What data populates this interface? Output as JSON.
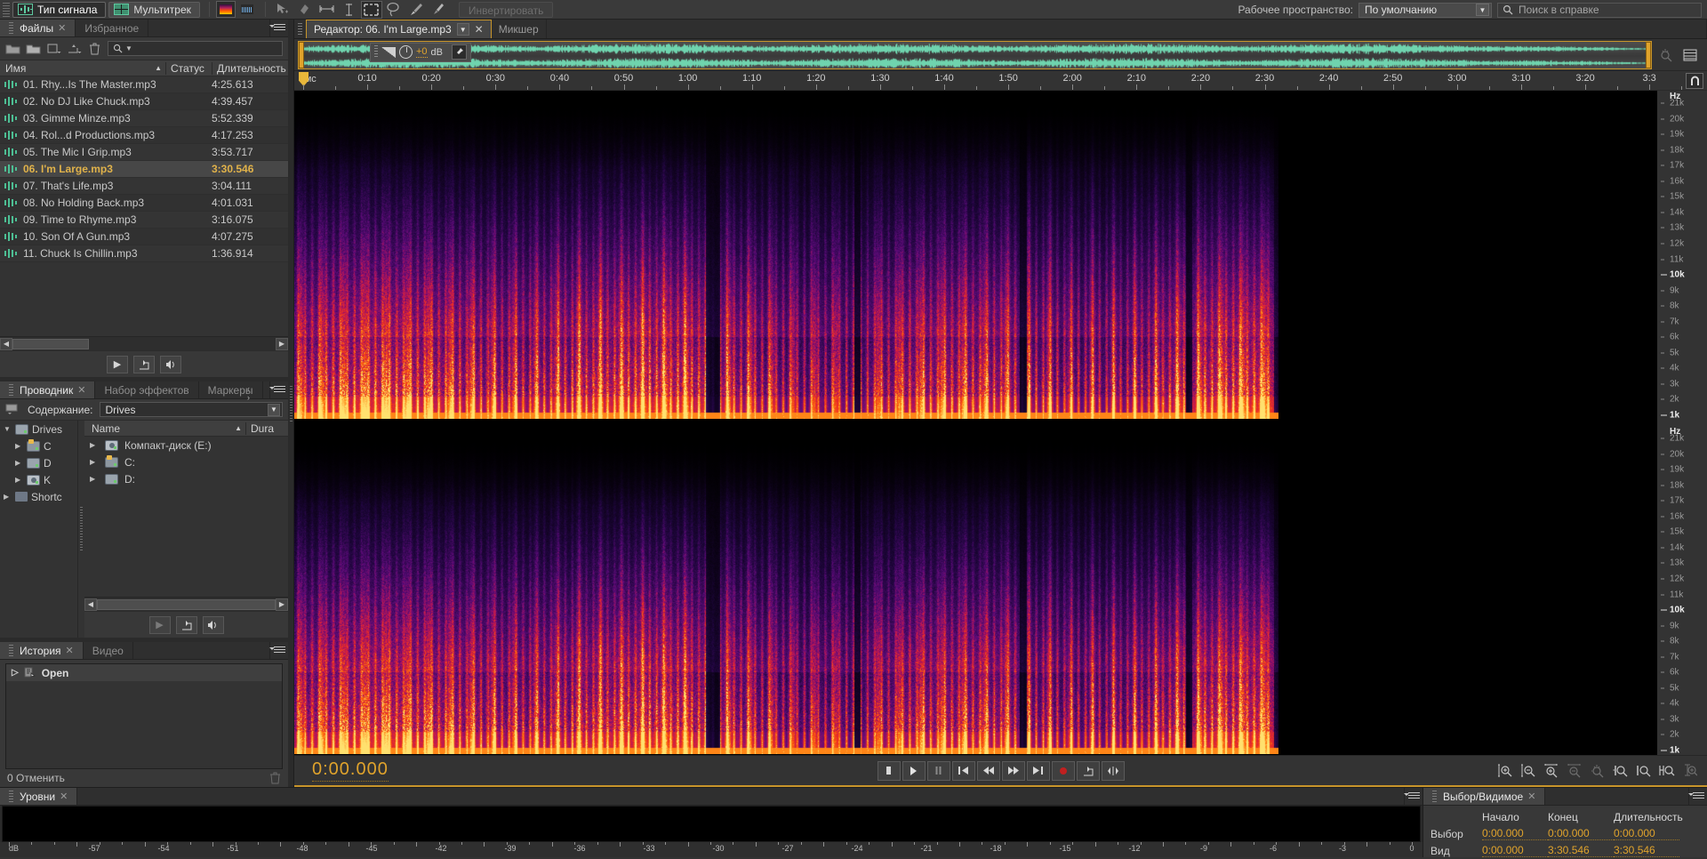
{
  "topbar": {
    "mode_waveform": "Тип сигнала",
    "mode_multitrack": "Мультитрек",
    "invert_label": "Инвертировать",
    "workspace_label": "Рабочее пространство:",
    "workspace_value": "По умолчанию",
    "help_placeholder": "Поиск в справке"
  },
  "files_panel": {
    "tabs": [
      {
        "label": "Файлы",
        "closable": true,
        "active": true
      },
      {
        "label": "Избранное",
        "closable": false,
        "active": false
      }
    ],
    "search_placeholder": "",
    "columns": [
      "Имя",
      "Статус",
      "Длительность"
    ],
    "rows": [
      {
        "name": "01. Rhy...Is The Master.mp3",
        "status": "",
        "duration": "4:25.613",
        "selected": false
      },
      {
        "name": "02. No DJ Like Chuck.mp3",
        "status": "",
        "duration": "4:39.457",
        "selected": false
      },
      {
        "name": "03. Gimme Minze.mp3",
        "status": "",
        "duration": "5:52.339",
        "selected": false
      },
      {
        "name": "04. Rol...d Productions.mp3",
        "status": "",
        "duration": "4:17.253",
        "selected": false
      },
      {
        "name": "05. The Mic I Grip.mp3",
        "status": "",
        "duration": "3:53.717",
        "selected": false
      },
      {
        "name": "06. I'm Large.mp3",
        "status": "",
        "duration": "3:30.546",
        "selected": true
      },
      {
        "name": "07. That's Life.mp3",
        "status": "",
        "duration": "3:04.111",
        "selected": false
      },
      {
        "name": "08. No Holding Back.mp3",
        "status": "",
        "duration": "4:01.031",
        "selected": false
      },
      {
        "name": "09. Time to Rhyme.mp3",
        "status": "",
        "duration": "3:16.075",
        "selected": false
      },
      {
        "name": "10. Son Of A Gun.mp3",
        "status": "",
        "duration": "4:07.275",
        "selected": false
      },
      {
        "name": "11. Chuck Is Chillin.mp3",
        "status": "",
        "duration": "1:36.914",
        "selected": false
      }
    ]
  },
  "explorer_panel": {
    "tabs": [
      {
        "label": "Проводник",
        "closable": true,
        "active": true
      },
      {
        "label": "Набор эффектов",
        "closable": false,
        "active": false
      },
      {
        "label": "Маркеры",
        "closable": false,
        "active": false
      }
    ],
    "content_label": "Содержание:",
    "content_value": "Drives",
    "tree": [
      {
        "label": "Drives",
        "indent": 0,
        "expanded": true,
        "icon": "drive-icon"
      },
      {
        "label": "C",
        "indent": 1,
        "expanded": false,
        "icon": "network-drive-icon"
      },
      {
        "label": "D",
        "indent": 1,
        "expanded": false,
        "icon": "drive-icon"
      },
      {
        "label": "K",
        "indent": 1,
        "expanded": false,
        "icon": "cd-drive-icon"
      },
      {
        "label": "Shortc",
        "indent": 0,
        "expanded": false,
        "icon": "shortcut-icon"
      }
    ],
    "columns": [
      "Name",
      "Dura"
    ],
    "rows": [
      {
        "name": "Компакт-диск (E:)",
        "icon": "cd-drive-icon"
      },
      {
        "name": "C:",
        "icon": "network-drive-icon"
      },
      {
        "name": "D:",
        "icon": "drive-icon"
      }
    ]
  },
  "history_panel": {
    "tabs": [
      {
        "label": "История",
        "closable": true,
        "active": true
      },
      {
        "label": "Видео",
        "closable": false,
        "active": false
      }
    ],
    "items": [
      {
        "label": "Open"
      }
    ],
    "footer": "0 Отменить"
  },
  "editor": {
    "tabs": [
      {
        "label": "Редактор: 06. I'm Large.mp3",
        "active": true,
        "has_dropdown": true,
        "closable": true
      },
      {
        "label": "Микшер",
        "active": false,
        "has_dropdown": false,
        "closable": false
      }
    ],
    "amplitude": {
      "value": "+0",
      "unit": "dB"
    },
    "timeline": {
      "unit": "чмс",
      "labels": [
        "0:10",
        "0:20",
        "0:30",
        "0:40",
        "0:50",
        "1:00",
        "1:10",
        "1:20",
        "1:30",
        "1:40",
        "1:50",
        "2:00",
        "2:10",
        "2:20",
        "2:30",
        "2:40",
        "2:50",
        "3:00",
        "3:10",
        "3:20",
        "3:3"
      ]
    },
    "frequency_axis": {
      "unit": "Hz",
      "labels": [
        "21k",
        "20k",
        "19k",
        "18k",
        "17k",
        "16k",
        "15k",
        "14k",
        "13k",
        "12k",
        "11k",
        "10k",
        "9k",
        "8k",
        "7k",
        "6k",
        "5k",
        "4k",
        "3k",
        "2k",
        "1k"
      ],
      "bold": [
        "10k",
        "1k"
      ]
    },
    "transport": {
      "timecode": "0:00.000",
      "buttons": [
        "stop",
        "play",
        "pause",
        "skip-start",
        "rewind",
        "fast-forward",
        "skip-end",
        "record",
        "loop",
        "shuttle"
      ]
    }
  },
  "levels_panel": {
    "tabs": [
      {
        "label": "Уровни",
        "closable": true,
        "active": true
      }
    ],
    "scale_unit": "dB",
    "scale_labels": [
      "-57",
      "-54",
      "-51",
      "-48",
      "-45",
      "-42",
      "-39",
      "-36",
      "-33",
      "-30",
      "-27",
      "-24",
      "-21",
      "-18",
      "-15",
      "-12",
      "-9",
      "-6",
      "-3",
      "0"
    ]
  },
  "selection_panel": {
    "tabs": [
      {
        "label": "Выбор/Видимое",
        "closable": true,
        "active": true
      }
    ],
    "columns": [
      "",
      "Начало",
      "Конец",
      "Длительность"
    ],
    "rows": [
      {
        "label": "Выбор",
        "start": "0:00.000",
        "end": "0:00.000",
        "duration": "0:00.000"
      },
      {
        "label": "Вид",
        "start": "0:00.000",
        "end": "3:30.546",
        "duration": "3:30.546"
      }
    ]
  },
  "colors": {
    "accent": "#e0a32c",
    "panel_bg": "#383838",
    "window_bg": "#2b2b2b",
    "waveform_green": "#4dbf94"
  }
}
